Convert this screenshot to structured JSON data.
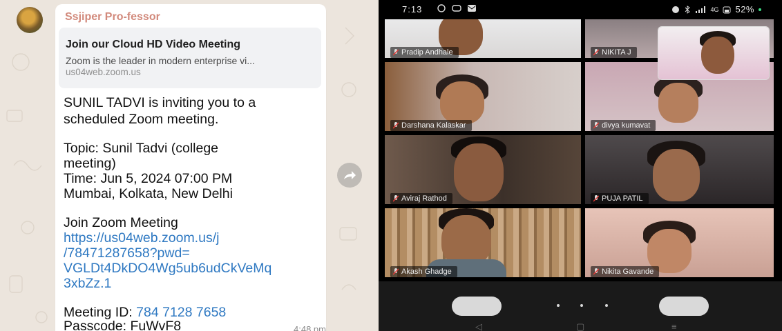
{
  "chat": {
    "sender": "Ssjiper Pro-fessor",
    "preview": {
      "title": "Join our Cloud HD Video Meeting",
      "description": "Zoom is the leader in modern enterprise vi...",
      "domain": "us04web.zoom.us"
    },
    "lines": {
      "invite1": "SUNIL TADVI is inviting you to a",
      "invite2": "scheduled Zoom meeting.",
      "topic1": "Topic: Sunil Tadvi (college",
      "topic2": "meeting)",
      "time": "Time: Jun 5, 2024 07:00 PM",
      "tz": "Mumbai, Kolkata, New Delhi",
      "join_label": "Join Zoom Meeting",
      "link1": "https://us04web.zoom.us/j",
      "link2": "/78471287658?pwd=",
      "link3": "VGLDt4DkDO4Wg5ub6udCkVeMq",
      "link4": "3xbZz.1",
      "meeting_id_label": "Meeting ID: ",
      "meeting_id": "784 7128 7658",
      "passcode": "Passcode: FuWvF8"
    },
    "timestamp": "4:48 pm",
    "forward_icon": "forward-arrow-icon"
  },
  "phone": {
    "status": {
      "time": "7:13",
      "battery": "52%",
      "network": "4G"
    },
    "participants": [
      {
        "name": "Pradip Andhale"
      },
      {
        "name": "NIKITA J"
      },
      {
        "name": "Darshana Kalaskar"
      },
      {
        "name": "divya kumavat"
      },
      {
        "name": "Aviraj Rathod"
      },
      {
        "name": "PUJA PATIL"
      },
      {
        "name": "Akash Ghadge"
      },
      {
        "name": "Nikita Gavande"
      }
    ],
    "nav": {
      "back": "◁",
      "home": "▢",
      "recents": "≡"
    }
  },
  "colors": {
    "link": "#2f79c2",
    "sender": "#d28a7c",
    "chat_bg": "#ece5dd"
  }
}
